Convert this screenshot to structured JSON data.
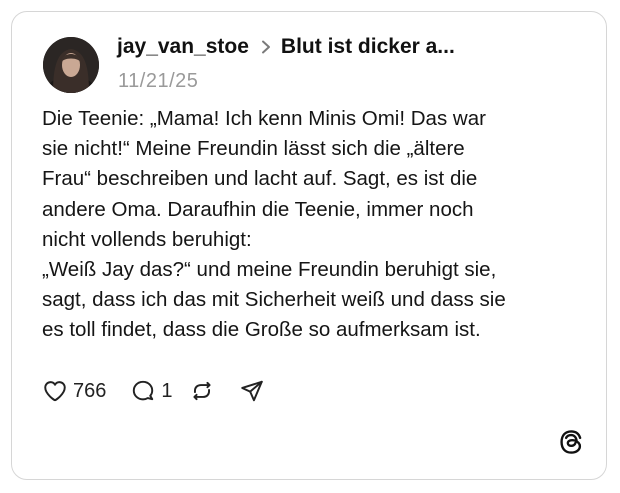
{
  "post": {
    "username": "jay_van_stoe",
    "topic": "Blut ist dicker a...",
    "date": "11/21/25",
    "lines": [
      "Die Teenie: „Mama! Ich kenn Minis Omi! Das war",
      "sie nicht!“ Meine Freundin lässt sich die „ältere",
      "Frau“ beschreiben und lacht auf. Sagt, es ist die",
      "andere Oma. Daraufhin die Teenie, immer noch",
      "nicht vollends beruhigt:",
      "„Weiß Jay das?“ und meine Freundin beruhigt sie,",
      "sagt, dass ich das mit Sicherheit weiß und dass sie",
      "es toll findet, dass die Große so aufmerksam ist."
    ]
  },
  "actions": {
    "likes": "766",
    "replies": "1"
  },
  "icons": {
    "chevron": "chevron-right-icon",
    "like": "heart-icon",
    "reply": "comment-icon",
    "repost": "repost-icon",
    "share": "send-icon",
    "brand": "threads-logo-icon"
  }
}
